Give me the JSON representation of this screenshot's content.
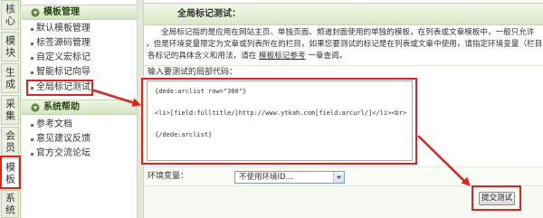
{
  "colors": {
    "page_bg": "#e9eee2",
    "tab_bg": "#e9efdf",
    "tab_border": "#c2d0ad",
    "header_bg_top": "#f0f6e6",
    "header_bg_bottom": "#d4e4c0",
    "header_text": "#274712",
    "link": "#333333",
    "annotation_red": "#e3201b"
  },
  "left_tabs": [
    {
      "label": "核心"
    },
    {
      "label": "模块"
    },
    {
      "label": "生成"
    },
    {
      "label": "采集"
    },
    {
      "label": "会员"
    },
    {
      "label": "模板"
    },
    {
      "label": "系统"
    }
  ],
  "sidebar": {
    "sections": [
      {
        "title": "模板管理",
        "icon": "collapse-arrow-icon",
        "items": [
          {
            "label": "默认模板管理",
            "icon": "bullet-icon"
          },
          {
            "label": "标签源码管理",
            "icon": "bullet-icon"
          },
          {
            "label": "自定义宏标记",
            "icon": "bullet-icon"
          },
          {
            "label": "智能标记向导",
            "icon": "bullet-icon"
          },
          {
            "label": "全局标记测试",
            "icon": "bullet-icon"
          }
        ]
      },
      {
        "title": "系统帮助",
        "icon": "collapse-arrow-icon",
        "items": [
          {
            "label": "参考文档",
            "icon": "bullet-icon"
          },
          {
            "label": "意见建议反馈",
            "icon": "bullet-icon"
          },
          {
            "label": "官方交流论坛",
            "icon": "bullet-icon"
          }
        ]
      }
    ]
  },
  "main": {
    "title": "全局标记测试：",
    "description": {
      "line1": "全局标记指的是应用在网站主页、单独页面、频道封面使用的单独的模板，在列表或文章模板中，一般只允许",
      "line2": "，但是环境变量限定为文章或列表所在的栏目，如果您要测试的标记是在列表或文章中使用，请指定环境变量（栏目 I",
      "line3_prefix": "各标记的具体含义和用法，请在 ",
      "line3_link": "模板标记参考",
      "line3_suffix": " 一章查阅。"
    },
    "code_label": "输入要测试的局部代码：",
    "code_value": "{dede:arclist row=\"300\"}\n\n<li>[field:fulltitle/]http://www.ytkah.com[field:arcurl/]</li><br>\n\n{/dede:arclist}",
    "env_label": "环境变量：",
    "env_select": {
      "selected": "不使用环境ID...",
      "icon": "dropdown-arrow-icon"
    },
    "submit_label": "提交测试"
  }
}
